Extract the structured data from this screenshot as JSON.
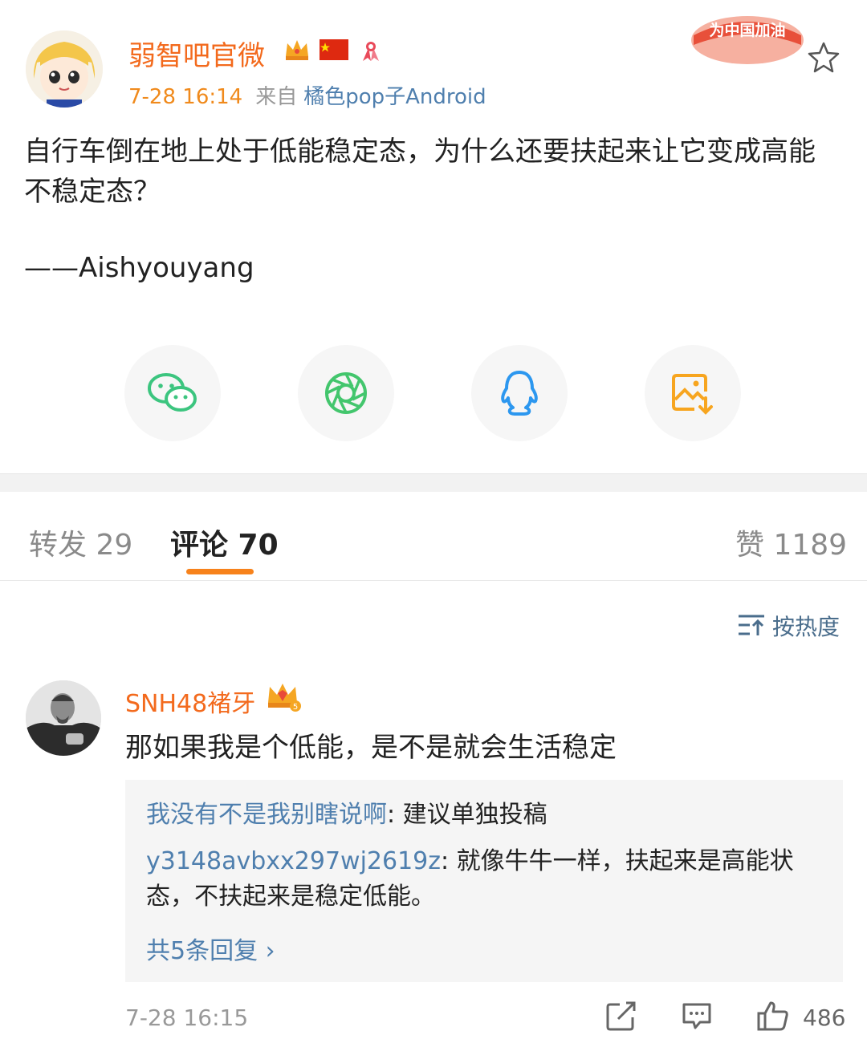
{
  "post": {
    "author": "弱智吧官微",
    "time": "7-28 16:14",
    "from_label": "来自",
    "source": "橘色pop子Android",
    "promo_text": "为中国加油",
    "text": "自行车倒在地上处于低能稳定态，为什么还要扶起来让它变成高能不稳定态？",
    "signature": "——Aishyouyang",
    "share": [
      {
        "name": "wechat",
        "icon": "wechat-icon",
        "color": "#3cc57f"
      },
      {
        "name": "moments",
        "icon": "moments-icon",
        "color": "#43c66d"
      },
      {
        "name": "qq",
        "icon": "qq-icon",
        "color": "#2c97ef"
      },
      {
        "name": "save-image",
        "icon": "save-image-icon",
        "color": "#f7a51f"
      }
    ]
  },
  "tabs": {
    "repost": "转发 29",
    "comments": "评论 70",
    "likes": "赞 1189"
  },
  "sort_label": "按热度",
  "comment": {
    "author": "SNH48褚牙",
    "text": "那如果我是个低能，是不是就会生活稳定",
    "replies": [
      {
        "user": "我没有不是我别瞎说啊",
        "text": ": 建议单独投稿"
      },
      {
        "user": "y3148avbxx297wj2619z",
        "text": ": 就像牛牛一样，扶起来是高能状态，不扶起来是稳定低能。"
      }
    ],
    "more_replies": "共5条回复 ›",
    "time": "7-28 16:15",
    "like_count": "486"
  },
  "colors": {
    "accent": "#f36a1d",
    "link": "#4f7fae",
    "tab_indicator": "#f7821b"
  }
}
